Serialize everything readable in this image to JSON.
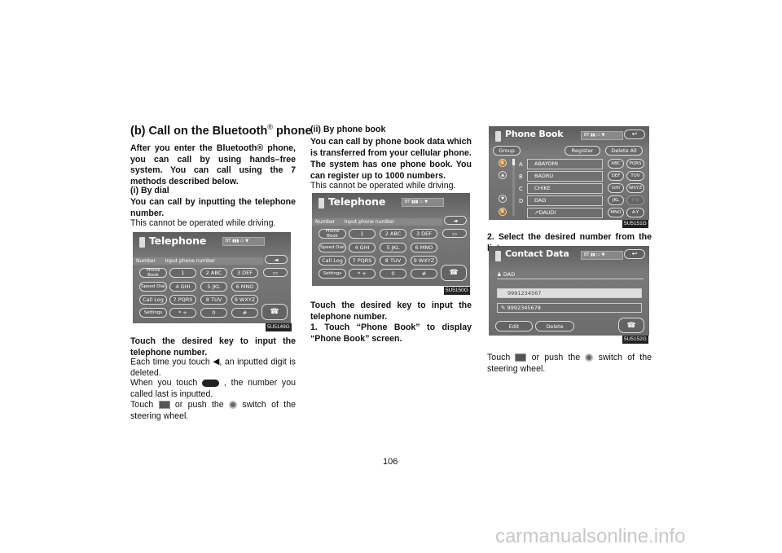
{
  "left": {
    "title": "(b) Call on the Bluetooth",
    "title_reg": "®",
    "title_end": " phone",
    "p1": "After you enter the Bluetooth® phone, you can call by using hands–free system.  You can call using the 7 methods described below.",
    "sub": "(i)   By dial",
    "p2": "You can call by inputting the telephone number.",
    "p3": "This cannot be operated while driving.",
    "fig": "5U5149G",
    "p4": "Touch the desired key to input the telephone number.",
    "p5a": "Each time you touch ",
    "p5b": ", an inputted digit is deleted.",
    "p6a": "When you touch ",
    "p6b": " , the number you called last is inputted.",
    "p7a": "Touch ",
    "p7b": " or push the ",
    "p7c": " switch of the steering wheel."
  },
  "middle": {
    "sub": "(ii)  By phone book",
    "p1": "You can call by phone book data which is transferred from your cellular phone.",
    "p2": "The system has one phone book.  You can register up to 1000 numbers.",
    "p3": "This cannot be operated while driving.",
    "fig": "5U5150G",
    "p4": "Touch the desired key to input the telephone number.",
    "p5": "1. Touch  “Phone  Book”  to  display “Phone Book” screen."
  },
  "right": {
    "fig1": "5U5151G",
    "p1": "2.  Select the desired number from the list.",
    "fig2": "5U5152G",
    "p2a": "Touch ",
    "p2b": " or push the ",
    "p2c": " switch of the steering wheel."
  },
  "telephone_screen": {
    "title": "Telephone",
    "status": "BT ▮▮▮ ▭ ▼",
    "number_label": "Number",
    "input_placeholder": "Input phone number",
    "side": [
      "Phone Book",
      "Speed Dial",
      "Call Log",
      "Settings"
    ],
    "keys": [
      "1",
      "2 ABC",
      "3 DEF",
      "4 GHI",
      "5 JKL",
      "6 MNO",
      "7 PQRS",
      "8 TUV",
      "9 WXYZ",
      "* +",
      "0",
      "#"
    ],
    "back": "◄",
    "redial": "▭",
    "call": "☎"
  },
  "phonebook_screen": {
    "title": "Phone Book",
    "status": "BT ▮▮ ▭ ▼",
    "return": "↩",
    "group": "Group",
    "register": "Register",
    "delete_all": "Delete All",
    "letters": [
      "A",
      "B",
      "C",
      "D",
      ""
    ],
    "names": [
      "ABAYOMI",
      "BADRU",
      "CHIKE",
      "DAD",
      "↗DAUDI"
    ],
    "index": [
      "ABC",
      "PQRS",
      "DEF",
      "TUV",
      "GHI",
      "WXYZ",
      "JKL",
      "0-9",
      "MNO",
      "A-Y"
    ],
    "index_disabled": [
      "0-9"
    ]
  },
  "contact_screen": {
    "title": "Contact Data",
    "status": "BT ▮▮ ▭ ▼",
    "return": "↩",
    "name": "DAD",
    "numbers": [
      "9991234567",
      "9992345678"
    ],
    "edit": "Edit",
    "delete": "Delete",
    "call": "☎"
  },
  "page_number": "106",
  "watermark": "carmanualsonline.info"
}
